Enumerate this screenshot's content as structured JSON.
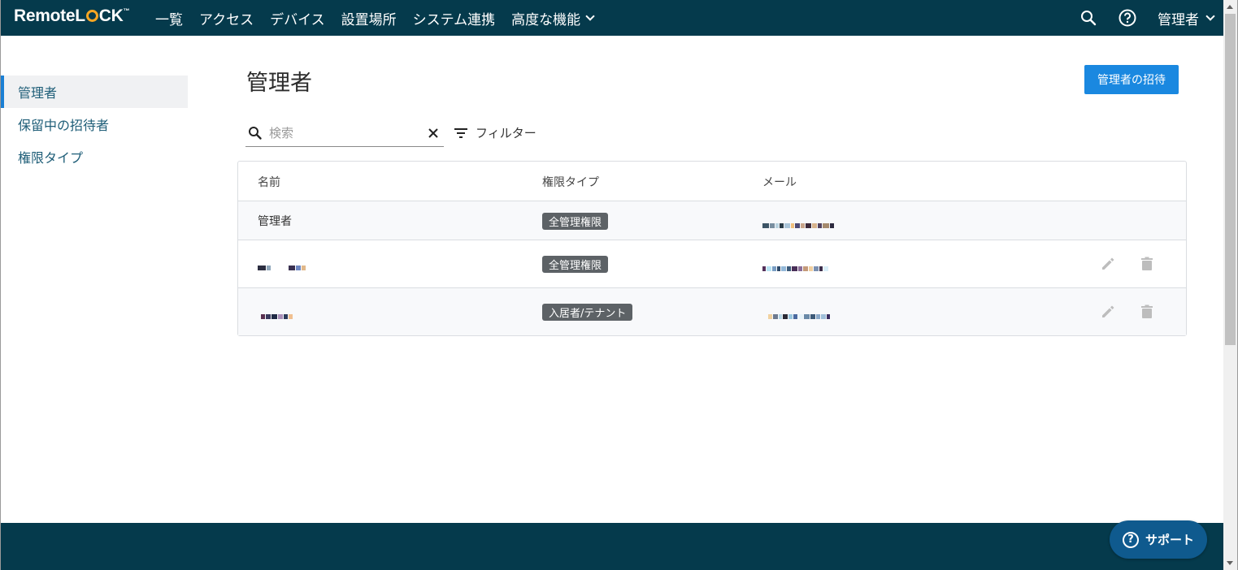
{
  "brand": {
    "logo_text_1": "Remote",
    "logo_text_2": "L",
    "logo_text_3": "CK",
    "logo_tm": "™"
  },
  "nav": {
    "items": [
      {
        "label": "一覧"
      },
      {
        "label": "アクセス"
      },
      {
        "label": "デバイス"
      },
      {
        "label": "設置場所"
      },
      {
        "label": "システム連携"
      },
      {
        "label": "高度な機能"
      }
    ],
    "user_label": "管理者"
  },
  "sidebar": {
    "items": [
      {
        "label": "管理者",
        "active": true
      },
      {
        "label": "保留中の招待者",
        "active": false
      },
      {
        "label": "権限タイプ",
        "active": false
      }
    ]
  },
  "main": {
    "title": "管理者",
    "invite_button": "管理者の招待",
    "search_placeholder": "検索",
    "filter_label": "フィルター"
  },
  "table": {
    "headers": {
      "name": "名前",
      "role": "権限タイプ",
      "email": "メール"
    },
    "rows": [
      {
        "name": "管理者",
        "role": "全管理権限",
        "email_redacted": true,
        "editable": false
      },
      {
        "name_redacted": true,
        "role": "全管理権限",
        "email_redacted": true,
        "editable": true
      },
      {
        "name_redacted": true,
        "role": "入居者/テナント",
        "email_redacted": true,
        "editable": true
      }
    ]
  },
  "support": {
    "label": "サポート",
    "icon": "?"
  },
  "colors": {
    "topbar": "#053a4c",
    "accent": "#1a88e0",
    "badge": "#5d6266",
    "sidebar_active": "#1a7fd4"
  }
}
